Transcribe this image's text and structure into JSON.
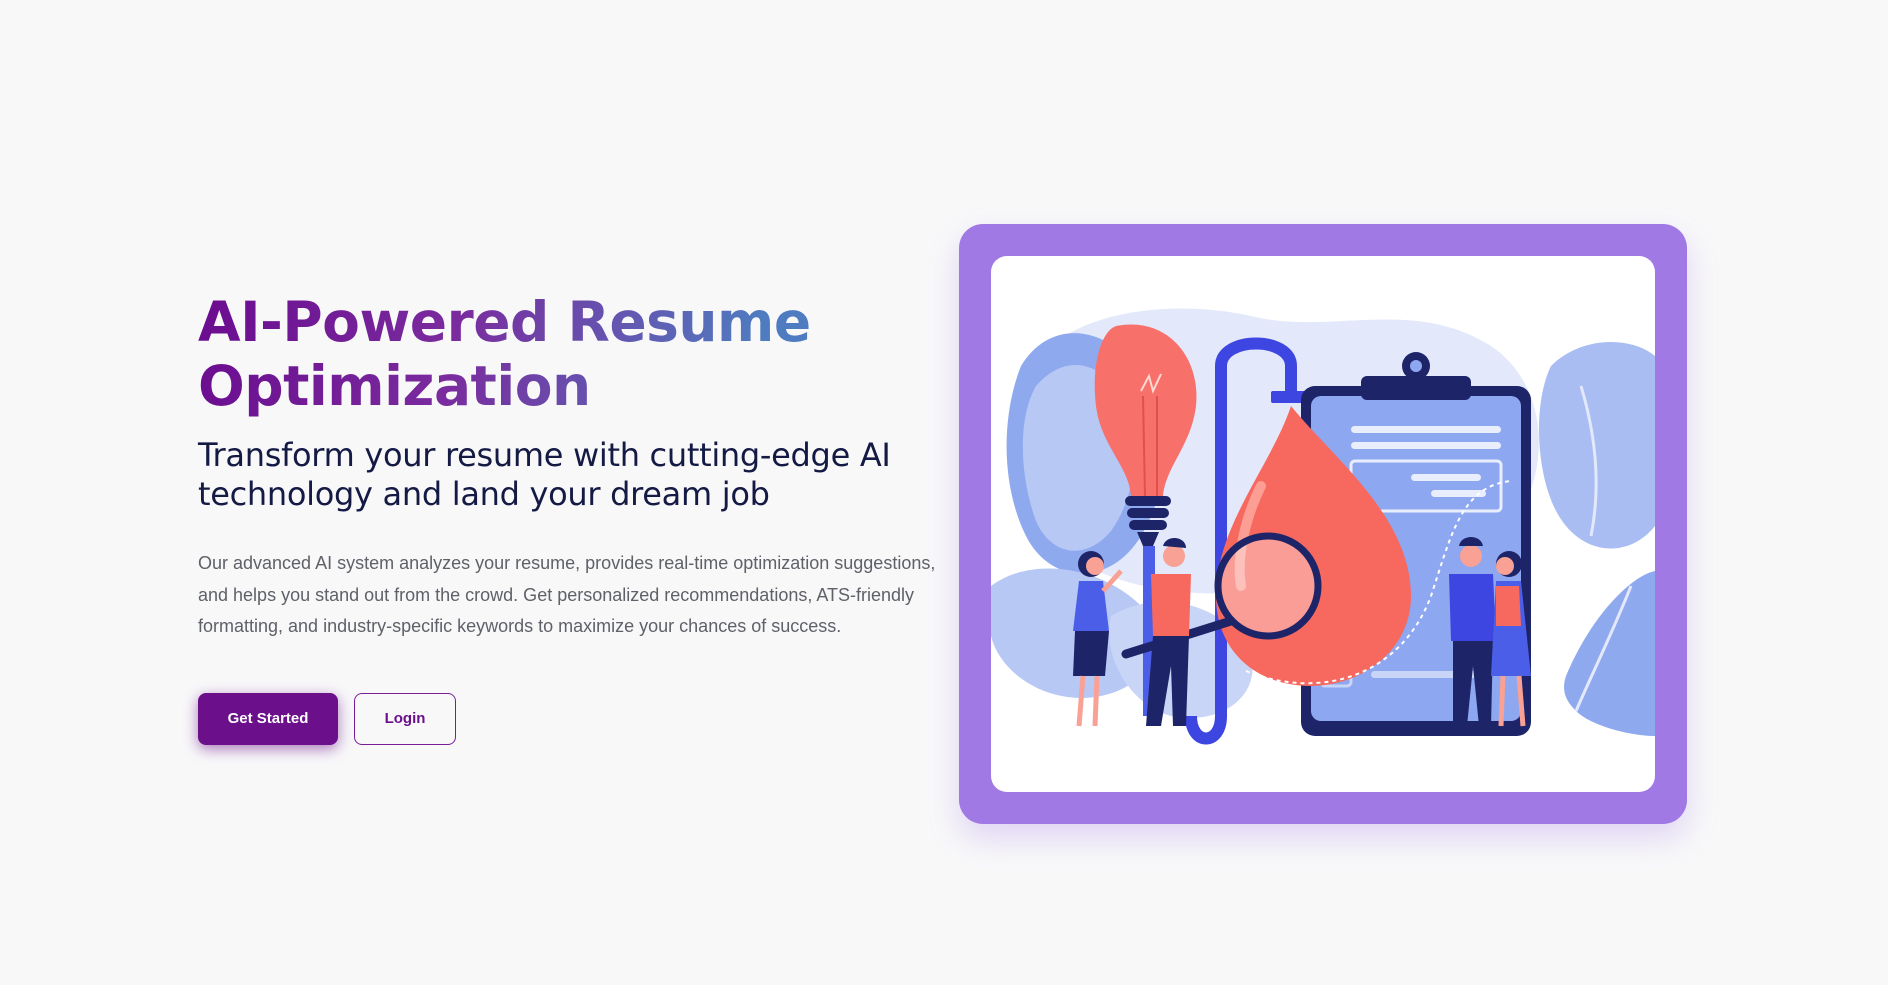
{
  "hero": {
    "title_line1": "AI-Powered Resume",
    "title_line2": "Optimization",
    "subtitle_line1": "Transform your resume with cutting-edge AI",
    "subtitle_line2": "technology and land your dream job",
    "description_line1": "Our advanced AI system analyzes your resume, provides real-time optimization suggestions,",
    "description_line2": "and helps you stand out from the crowd. Get personalized recommendations, ATS-friendly",
    "description_line3": "formatting, and industry-specific keywords to maximize your chances of success."
  },
  "actions": {
    "primary_label": "Get Started",
    "secondary_label": "Login"
  },
  "colors": {
    "background": "#f8f8f9",
    "accent": "#6b0f8b",
    "frame": "#a079e5",
    "title_gradient_start": "#6a0c8f",
    "title_gradient_end": "#4f7cc0",
    "subtitle": "#141a44",
    "body_text": "#5f6168"
  },
  "illustration": {
    "icon": "resume-optimization-illustration"
  }
}
